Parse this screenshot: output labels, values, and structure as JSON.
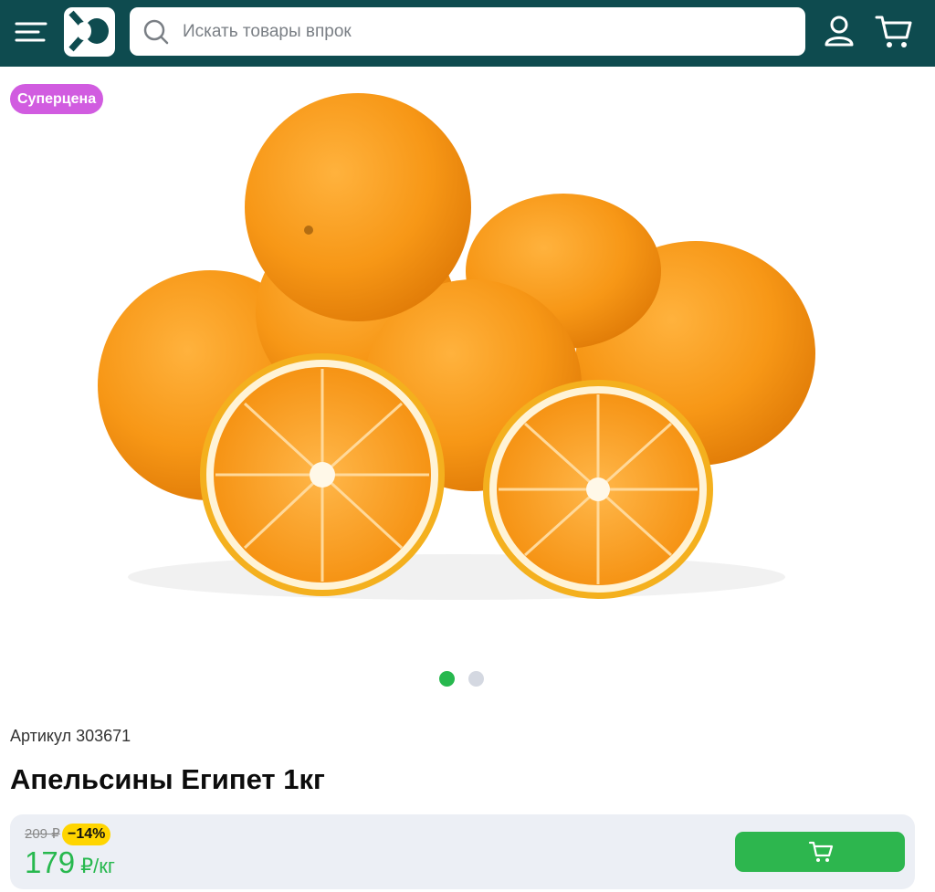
{
  "header": {
    "search_placeholder": "Искать товары впрок"
  },
  "icons": {
    "menu": "menu-icon",
    "logo": "store-logo",
    "search": "search-icon",
    "user": "user-icon",
    "cart": "cart-icon"
  },
  "product": {
    "badge": "Суперцена",
    "image_alt": "oranges",
    "gallery": {
      "total_slides": 2,
      "active_slide": 1
    },
    "article": "Артикул 303671",
    "title": "Апельсины Египет 1кг",
    "old_price": "209 ₽",
    "discount": "−14%",
    "price": "179",
    "price_unit": " ₽/кг"
  },
  "colors": {
    "header_bg": "#0e4b4f",
    "accent_green": "#27b84e",
    "badge_purple": "#d15ce0",
    "discount_yellow": "#ffd500",
    "panel_bg": "#eceff5"
  }
}
